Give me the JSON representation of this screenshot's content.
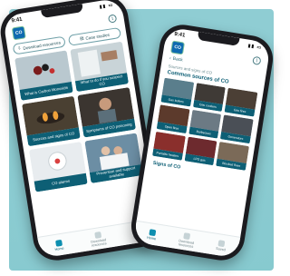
{
  "phone_home": {
    "status_time": "9:41",
    "logo_text": "CO",
    "buttons": [
      {
        "label": "Download resources",
        "icon": "download-icon"
      },
      {
        "label": "Case studies",
        "icon": "book-icon"
      }
    ],
    "tiles": [
      {
        "caption": "What is Carbon Monoxide",
        "color": "#b9c8cf"
      },
      {
        "caption": "What to do if you suspect CO",
        "color": "#c9d4d8"
      },
      {
        "caption": "Sources and signs of CO",
        "color": "#4a4032"
      },
      {
        "caption": "Symptoms of CO poisoning",
        "color": "#3b3530"
      },
      {
        "caption": "CO alarms",
        "color": "#e8ecef"
      },
      {
        "caption": "Prevention and support available",
        "color": "#6c8ea4"
      }
    ],
    "nav": [
      {
        "label": "Home",
        "active": true
      },
      {
        "label": "Download resources",
        "active": false
      },
      {
        "label": "Saved",
        "active": false
      }
    ]
  },
  "phone_detail": {
    "status_time": "9:41",
    "logo_text": "CO",
    "back_label": "Back",
    "breadcrumb": "Sources and signs of CO",
    "section_title": "Common sources of CO",
    "tiles": [
      {
        "caption": "Gas boilers",
        "color": "#5a7e8c"
      },
      {
        "caption": "Gas cookers",
        "color": "#3f3a36"
      },
      {
        "caption": "Gas fires",
        "color": "#4b3f35"
      },
      {
        "caption": "Open fires",
        "color": "#5c3a2c"
      },
      {
        "caption": "Barbecues",
        "color": "#6c7a84"
      },
      {
        "caption": "Generators",
        "color": "#4a4f56"
      },
      {
        "caption": "Portable heaters",
        "color": "#8a2f2c"
      },
      {
        "caption": "LPG gas",
        "color": "#6d2a2e"
      },
      {
        "caption": "Blocked flues",
        "color": "#7b6a58"
      }
    ],
    "sub_title": "Signs of CO",
    "nav": [
      {
        "label": "Home",
        "active": true
      },
      {
        "label": "Download resources",
        "active": false
      },
      {
        "label": "Saved",
        "active": false
      }
    ]
  }
}
